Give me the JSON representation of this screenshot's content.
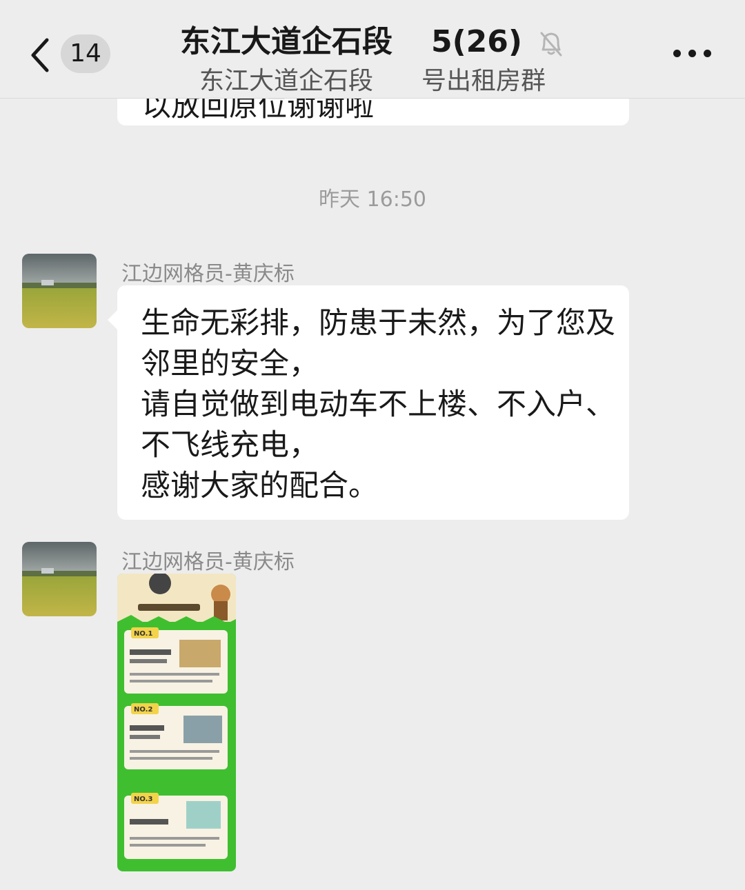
{
  "header": {
    "unread_count": "14",
    "title": "东江大道企石段",
    "title_count": "5(26)",
    "subtitle_left": "东江大道企石段",
    "subtitle_right": "号出租房群",
    "back_icon": "chevron-left-icon",
    "mute_icon": "bell-off-icon",
    "more_icon": "ellipsis-icon"
  },
  "partial_message": {
    "text": "以放回原位谢谢啦"
  },
  "timestamp": "昨天 16:50",
  "messages": [
    {
      "sender": "江边网格员-黄庆标",
      "text": "生命无彩排，防患于未然，为了您及邻里的安全，\n请自觉做到电动车不上楼、不入户、不飞线充电，\n感谢大家的配合。"
    },
    {
      "sender": "江边网格员-黄庆标",
      "image_labels": [
        "NO.1",
        "NO.2",
        "NO.3"
      ]
    }
  ],
  "colors": {
    "background": "#ededed",
    "bubble": "#ffffff",
    "poster_green": "#3fbf2f",
    "poster_cream": "#f3e7c3"
  }
}
